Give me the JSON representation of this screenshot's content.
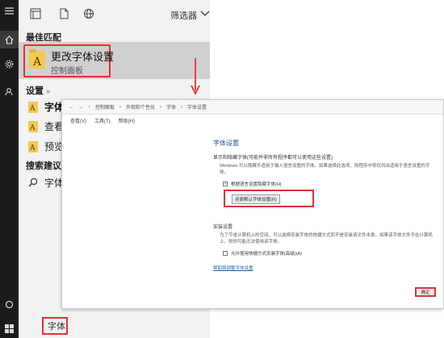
{
  "pane": {
    "filter_label": "筛选器",
    "best_match_title": "最佳匹配",
    "best_match": {
      "name": "更改字体设置",
      "subtitle": "控制面板"
    },
    "settings_title": "设置",
    "settings_chevron": "»",
    "settings_items": [
      "字体",
      "查看",
      "预览"
    ],
    "suggestions_title": "搜索建议",
    "suggestion": "字体",
    "search_text": "字体"
  },
  "window": {
    "breadcrumbs": [
      "控制面板",
      "外观和个性化",
      "字体",
      "字体设置"
    ],
    "menu": [
      "查看(V)",
      "工具(T)",
      "帮助(H)"
    ],
    "heading": "字体设置",
    "section1_title": "显示和隐藏字体(可能并非所有程序都可以使用这些设置)",
    "section1_desc": "Windows 可以隐藏不适用于输入语言设置的字体。如果选择此选项，则程序中将仅列出适用于语言设置的字体。",
    "check1_label": "根据语言设置隐藏字体(H)",
    "check1_mark": "✓",
    "restore_button": "还原默认字体设置(R)",
    "section2_title": "安装设置",
    "section2_desc": "为了节省计算机上的空间，可以选择安装字体的快捷方式而不是安装该文件本身。如果该字体文件不在计算机上，则你可能无法使用该字体。",
    "check2_label": "允许使用快捷方式安装字体(高级)(A)",
    "link": "帮助我调整字体设置",
    "ok_button": "确定"
  },
  "icons": {
    "home": "home-icon",
    "settings": "gear-icon",
    "person": "person-icon",
    "circle": "circle-icon",
    "windows": "windows-logo-icon",
    "document": "document-icon",
    "globe": "globe-icon",
    "apps": "apps-icon"
  },
  "colors": {
    "highlight": "#e13232",
    "rail": "#1b1b1b",
    "pane": "#f2f2f2",
    "selected": "#d0d0d0"
  }
}
